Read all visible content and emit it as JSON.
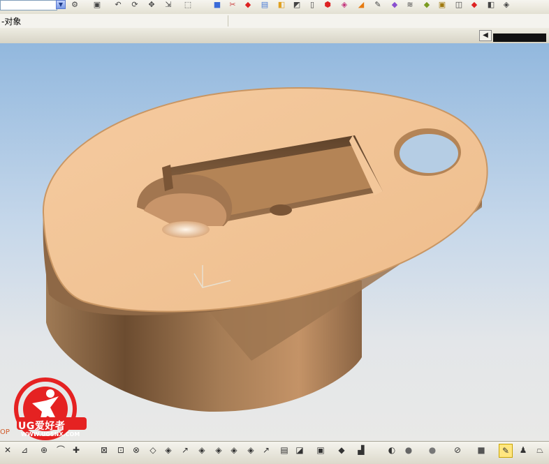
{
  "toolbar": {
    "icons": [
      "tool-icon",
      "snap-icon",
      "undo-icon",
      "rotate-icon",
      "pan-icon",
      "move-icon",
      "select-box-icon",
      "cube-icon",
      "cut-icon",
      "red-solid-icon",
      "box-icon",
      "extrude-icon",
      "shell-icon",
      "doc-icon",
      "color-icon",
      "shade-icon",
      "eraser-icon",
      "edit-icon",
      "layer-icon",
      "stack-icon",
      "wire-icon",
      "blend-icon",
      "palette-icon",
      "diamond-icon"
    ]
  },
  "filter_bar": {
    "label": "-对象"
  },
  "bottom_toolbar": {
    "icons": [
      "snap-endpoint-icon",
      "snap-mid-icon",
      "snap-center-icon",
      "snap-quad-icon",
      "snap-point-icon",
      "snap-intersect-icon",
      "snap-tangent-icon",
      "snap-pole-icon",
      "snap-face-icon",
      "snap-curve-icon",
      "snap-arc-icon",
      "snap-bound-icon",
      "snap-grid-icon",
      "snap-edge-icon",
      "snap-vertex-icon",
      "snap-axis-icon",
      "ruler-icon",
      "measure-icon",
      "layer-visibility-icon",
      "view-cube-icon",
      "coordinate-icon",
      "shade-sphere-icon",
      "circle-icon",
      "dot-icon",
      "no-entry-icon",
      "square-fill-icon",
      "highlight-icon",
      "person-icon",
      "trapezoid-icon"
    ]
  },
  "watermark": {
    "title": "UG爱好者",
    "url": "WWW.UGSNX.COM"
  },
  "op_label": "OP",
  "colors": {
    "part": "#f0c393",
    "part_shadow": "#7d5638",
    "sky_top": "#92b8de",
    "floor": "#e9e9e7",
    "watermark_red": "#e52222"
  }
}
